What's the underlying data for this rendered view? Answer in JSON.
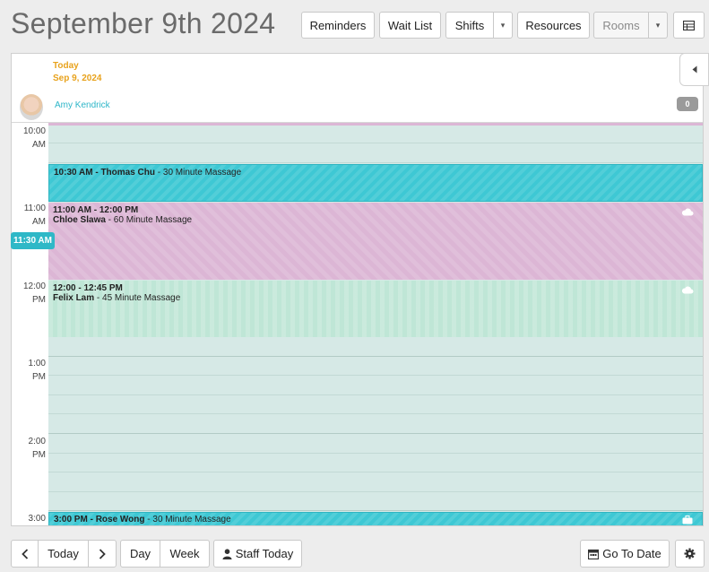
{
  "header": {
    "title": "September 9th 2024"
  },
  "toolbar": {
    "reminders": "Reminders",
    "wait_list": "Wait List",
    "shifts": "Shifts",
    "resources": "Resources",
    "rooms": "Rooms"
  },
  "calendar": {
    "today_label": "Today",
    "today_date": "Sep 9, 2024",
    "staff_name": "Amy Kendrick",
    "staff_count": "0",
    "current_time": "11:30 AM",
    "times": [
      {
        "hour": "10:00",
        "ampm": "AM"
      },
      {
        "hour": "11:00",
        "ampm": "AM"
      },
      {
        "hour": "12:00",
        "ampm": "PM"
      },
      {
        "hour": "1:00",
        "ampm": "PM"
      },
      {
        "hour": "2:00",
        "ampm": "PM"
      },
      {
        "hour": "3:00",
        "ampm": ""
      }
    ],
    "appointments": [
      {
        "time": "10:30 AM",
        "client": "Thomas Chu",
        "service": "30 Minute Massage"
      },
      {
        "time": "11:00 AM - 12:00 PM",
        "client": "Chloe Slawa",
        "service": "60 Minute Massage"
      },
      {
        "time": "12:00 - 12:45 PM",
        "client": "Felix Lam",
        "service": "45 Minute Massage"
      },
      {
        "time": "3:00 PM",
        "client": "Rose Wong",
        "service": "30 Minute Massage"
      }
    ],
    "sep": " - ",
    "service_sep": " - "
  },
  "footer": {
    "today": "Today",
    "day": "Day",
    "week": "Week",
    "staff_today": "Staff Today",
    "go_to_date": "Go To Date"
  },
  "colors": {
    "accent": "#2db6c8",
    "today": "#e8a21c",
    "teal_appt": "#3ec8d4",
    "pink_appt": "#dcb6d5",
    "green_appt": "#bfe6d6"
  }
}
